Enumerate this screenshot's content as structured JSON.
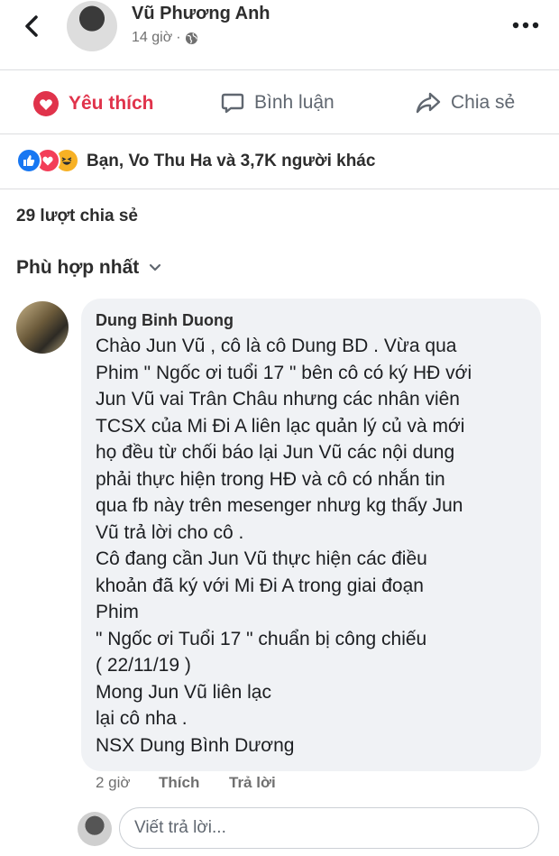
{
  "header": {
    "author": "Vũ Phương Anh",
    "time": "14 giờ",
    "separator": "·"
  },
  "actions": {
    "like": "Yêu thích",
    "comment": "Bình luận",
    "share": "Chia sẻ"
  },
  "reactions": {
    "icons": [
      "like-icon",
      "love-icon",
      "haha-icon"
    ],
    "summary": "Bạn, Vo Thu Ha và 3,7K người khác"
  },
  "shares": "29 lượt chia sẻ",
  "sort": "Phù hợp nhất",
  "comment": {
    "author": "Dung Binh Duong",
    "lines": [
      "Chào Jun Vũ , cô là cô Dung BD . Vừa qua",
      "Phim \" Ngốc ơi tuổi 17 \" bên cô có ký HĐ với",
      "Jun Vũ vai Trân Châu nhưng các nhân viên",
      "TCSX của Mi Đi A liên lạc quản lý củ và mới",
      "họ đều từ chối báo lại Jun Vũ các nội dung",
      "phải thực hiện trong HĐ và cô có nhắn tin",
      "qua fb này trên mesenger nhưg kg thấy Jun",
      "Vũ trả lời cho cô .",
      "Cô đang cần Jun Vũ thực hiện các điều",
      "khoản đã ký với Mi Đi A trong giai đoạn",
      "Phim",
      "\" Ngốc ơi Tuổi 17 \" chuẩn bị công chiếu",
      "( 22/11/19 )",
      "Mong Jun Vũ liên lạc",
      "lại cô nha .",
      "NSX Dung Bình Dương"
    ],
    "time": "2 giờ",
    "like": "Thích",
    "reply": "Trả lời"
  },
  "reply_box": {
    "placeholder": "Viết trả lời..."
  },
  "colors": {
    "like_red": "#e0334b",
    "reaction_like": "#1877f2",
    "reaction_love": "#f33e58",
    "reaction_haha": "#f7b125",
    "bubble": "#f0f2f5"
  }
}
